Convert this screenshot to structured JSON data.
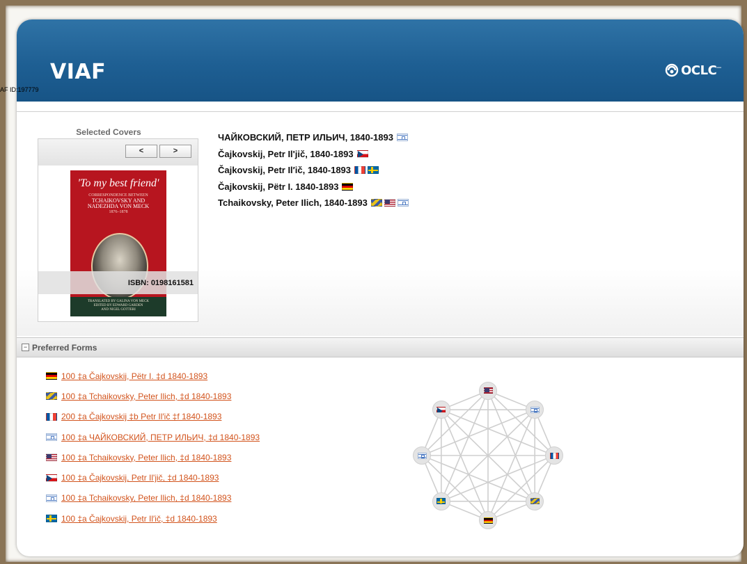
{
  "header": {
    "title": "VIAF",
    "logo_text": "OCLC"
  },
  "record": {
    "id_label": "AF ID:197779"
  },
  "covers": {
    "title": "Selected Covers",
    "prev_label": "<",
    "next_label": ">",
    "book": {
      "title": "'To my best friend'",
      "subtitle_1": "CORRESPONDENCE BETWEEN",
      "subtitle_2": "TCHAIKOVSKY AND",
      "subtitle_3": "NADEZHDA VON MECK",
      "years": "1876–1878",
      "credit_1": "TRANSLATED BY GALINA VON MECK",
      "credit_2": "EDITED BY EDWARD GARDEN",
      "credit_3": "AND NIGEL GOTTERI"
    },
    "isbn": "ISBN: 0198161581"
  },
  "names": [
    {
      "text": "ЧАЙКОВСКИЙ, ПЕТР ИЛЬИЧ, 1840-1893",
      "flags": [
        "il"
      ]
    },
    {
      "text": "Čajkovskij, Petr Il'jič, 1840-1893",
      "flags": [
        "cz"
      ]
    },
    {
      "text": "Čajkovskij, Petr Il′ič, 1840-1893",
      "flags": [
        "fr",
        "se"
      ]
    },
    {
      "text": "Čajkovskij, Pëtr I. 1840-1893",
      "flags": [
        "de"
      ]
    },
    {
      "text": "Tchaikovsky, Peter Ilich, 1840-1893",
      "flags": [
        "intl",
        "us",
        "il"
      ]
    }
  ],
  "preferred_forms": {
    "section_title": "Preferred Forms",
    "toggle_symbol": "−",
    "items": [
      {
        "flag": "de",
        "text": "100 ‡a  Čajkovskij, Pëtr I. ‡d  1840-1893"
      },
      {
        "flag": "intl",
        "text": "100 ‡a  Tchaikovsky, Peter Ilich, ‡d  1840-1893"
      },
      {
        "flag": "fr",
        "text": "200 ‡a  Čajkovskij ‡b  Petr Il′ič ‡f  1840-1893"
      },
      {
        "flag": "il",
        "text": "100 ‡a  ЧАЙКОВСКИЙ, ПЕТР ИЛЬИЧ, ‡d  1840-1893"
      },
      {
        "flag": "us",
        "text": "100 ‡a  Tchaikovsky, Peter Ilich, ‡d  1840-1893"
      },
      {
        "flag": "cz",
        "text": "100 ‡a  Čajkovskij, Petr Il'jič, ‡d  1840-1893"
      },
      {
        "flag": "il",
        "text": "100 ‡a  Tchaikovsky, Peter Ilich, ‡d  1840-1893"
      },
      {
        "flag": "se",
        "text": "100 ‡a  Čajkovskij, Petr Il′ič, ‡d  1840-1893"
      }
    ]
  },
  "graph": {
    "nodes": [
      "us",
      "il",
      "fr",
      "intl",
      "de",
      "se",
      "il",
      "cz"
    ]
  },
  "colors": {
    "header_blue": "#1e5f93",
    "link_orange": "#d2531c"
  }
}
